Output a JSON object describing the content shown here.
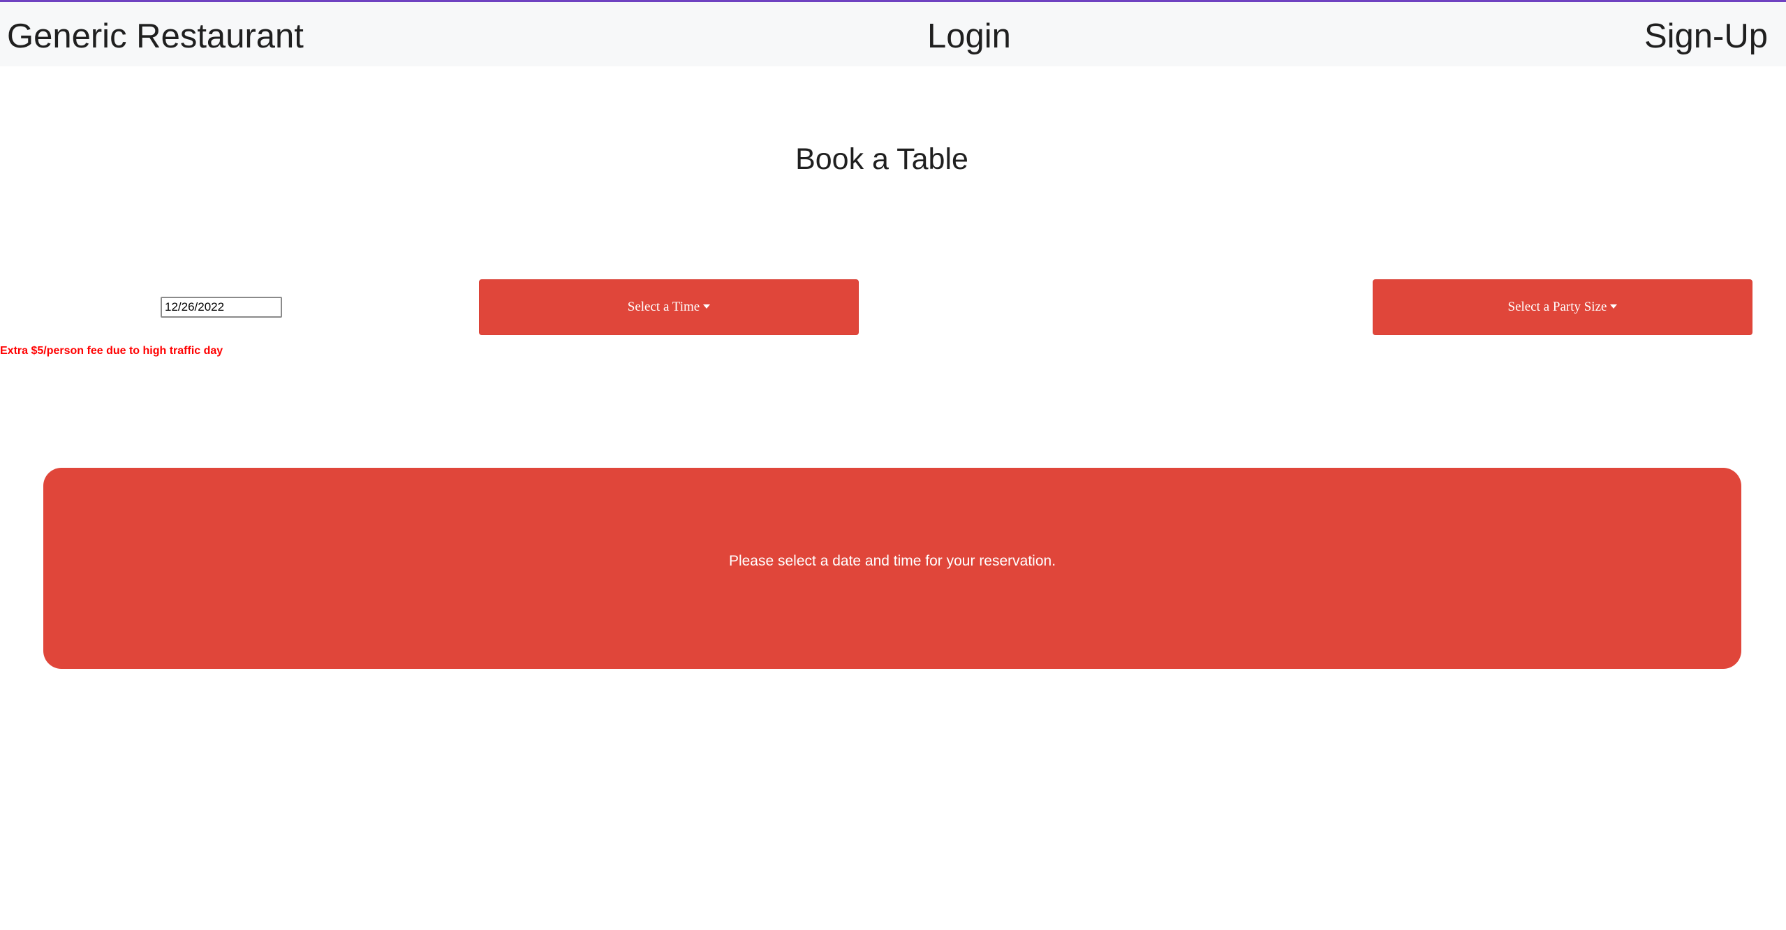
{
  "navbar": {
    "brand": "Generic Restaurant",
    "login": "Login",
    "signup": "Sign-Up"
  },
  "booking": {
    "title": "Book a Table",
    "date_value": "12/26/2022",
    "time_dropdown_label": "Select a Time",
    "party_dropdown_label": "Select a Party Size",
    "fee_notice": "Extra $5/person fee due to high traffic day",
    "message": "Please select a date and time for your reservation."
  },
  "colors": {
    "accent_red": "#e0463a",
    "notice_red": "#ff0000",
    "navbar_bg": "#f7f8f9",
    "top_border": "#6f42c1"
  }
}
